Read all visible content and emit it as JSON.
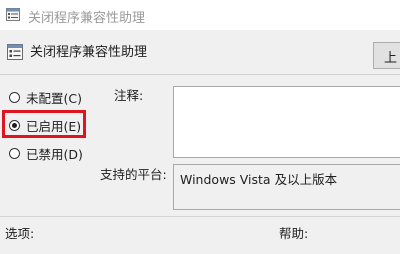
{
  "window": {
    "title": "关闭程序兼容性助理",
    "icon": "policy-setting-icon"
  },
  "header": {
    "title": "关闭程序兼容性助理",
    "icon": "policy-setting-icon",
    "prev_button_label": "上"
  },
  "options": [
    {
      "label": "未配置(C)",
      "checked": false
    },
    {
      "label": "已启用(E)",
      "checked": true
    },
    {
      "label": "已禁用(D)",
      "checked": false
    }
  ],
  "highlight_color": "#e0141e",
  "fields": {
    "comment_label": "注释:",
    "comment_value": "",
    "supported_label": "支持的平台:",
    "supported_value": "Windows Vista 及以上版本"
  },
  "sections": {
    "options_label": "选项:",
    "help_label": "帮助:"
  }
}
